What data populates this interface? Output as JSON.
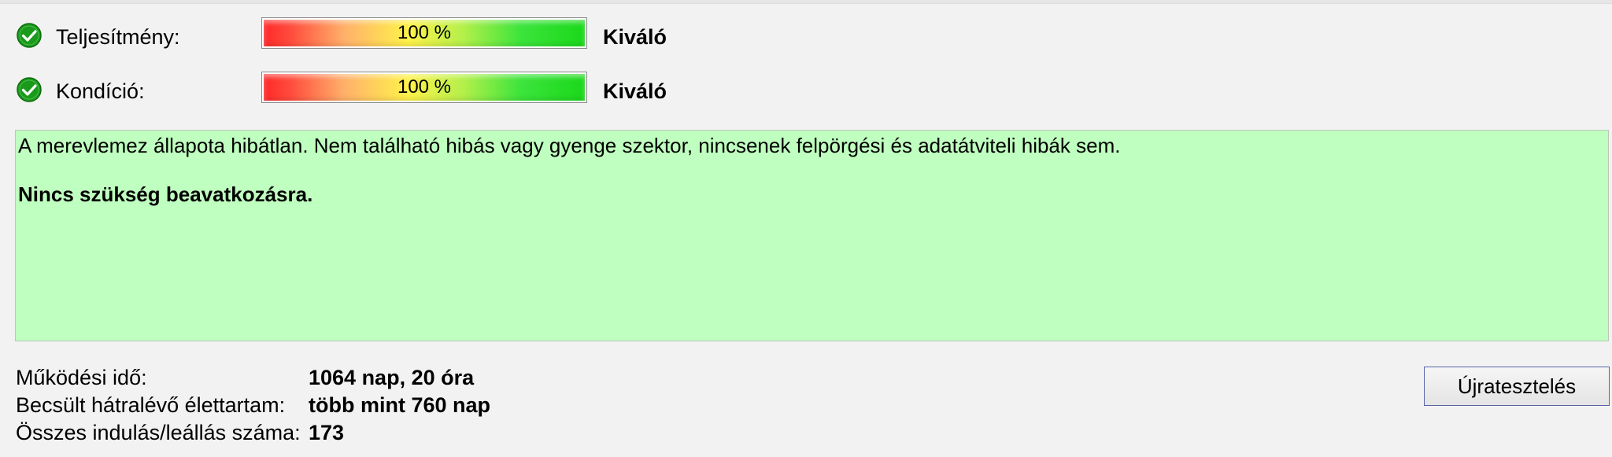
{
  "metrics": [
    {
      "label": "Teljesítmény:",
      "bar_text": "100 %",
      "value_percent": 100,
      "rating": "Kiváló",
      "icon": "check-circle-icon"
    },
    {
      "label": "Kondíció:",
      "bar_text": "100 %",
      "value_percent": 100,
      "rating": "Kiváló",
      "icon": "check-circle-icon"
    }
  ],
  "message": {
    "text": "A merevlemez állapota hibátlan. Nem található hibás vagy gyenge szektor, nincsenek felpörgési és adatátviteli hibák sem.",
    "bold": "Nincs szükség beavatkozásra.",
    "background": "#bfffbf"
  },
  "info": [
    {
      "key": "Működési idő:",
      "value": "1064 nap, 20 óra"
    },
    {
      "key": "Becsült hátralévő élettartam:",
      "value": "több mint 760 nap"
    },
    {
      "key": "Összes indulás/leállás száma:",
      "value": "173"
    }
  ],
  "retest_label": "Újratesztelés",
  "colors": {
    "ok_green": "#1a9a1a",
    "button_border": "#5a63a8"
  }
}
